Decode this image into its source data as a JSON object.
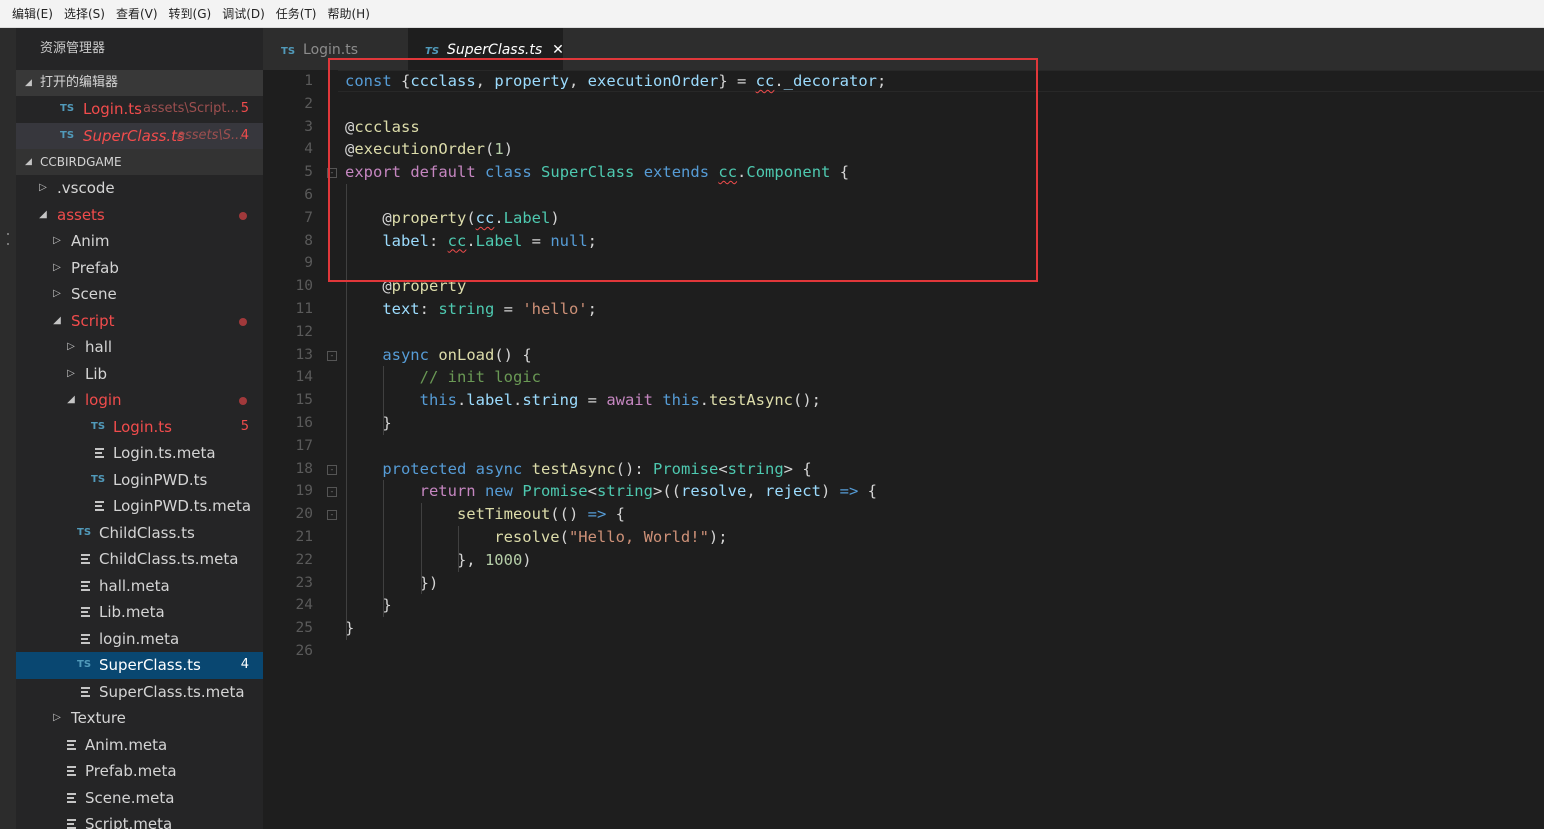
{
  "menu": [
    "编辑(E)",
    "选择(S)",
    "查看(V)",
    "转到(G)",
    "调试(D)",
    "任务(T)",
    "帮助(H)"
  ],
  "sidebar": {
    "title": "资源管理器",
    "open_editors": {
      "header": "打开的编辑器",
      "items": [
        {
          "icon": "TS",
          "name": "Login.ts",
          "path": "assets\\Script...",
          "badge": "5"
        },
        {
          "icon": "TS",
          "name": "SuperClass.ts",
          "path": "assets\\S...",
          "badge": "4"
        }
      ]
    },
    "project": {
      "header": "CCBIRDGAME",
      "items": [
        {
          "name": ".vscode",
          "type": "folder",
          "indent": 0,
          "expanded": false,
          "error": false,
          "badge": ""
        },
        {
          "name": "assets",
          "type": "folder",
          "indent": 0,
          "expanded": true,
          "error": true,
          "badge": ""
        },
        {
          "name": "Anim",
          "type": "folder",
          "indent": 1,
          "expanded": false,
          "error": false,
          "badge": ""
        },
        {
          "name": "Prefab",
          "type": "folder",
          "indent": 1,
          "expanded": false,
          "error": false,
          "badge": ""
        },
        {
          "name": "Scene",
          "type": "folder",
          "indent": 1,
          "expanded": false,
          "error": false,
          "badge": ""
        },
        {
          "name": "Script",
          "type": "folder",
          "indent": 1,
          "expanded": true,
          "error": true,
          "badge": ""
        },
        {
          "name": "hall",
          "type": "folder",
          "indent": 2,
          "expanded": false,
          "error": false,
          "badge": ""
        },
        {
          "name": "Lib",
          "type": "folder",
          "indent": 2,
          "expanded": false,
          "error": false,
          "badge": ""
        },
        {
          "name": "login",
          "type": "folder",
          "indent": 2,
          "expanded": true,
          "error": true,
          "badge": ""
        },
        {
          "name": "Login.ts",
          "type": "ts",
          "indent": 3,
          "expanded": false,
          "error": true,
          "badge": "5"
        },
        {
          "name": "Login.ts.meta",
          "type": "meta",
          "indent": 3,
          "expanded": false,
          "error": false,
          "badge": ""
        },
        {
          "name": "LoginPWD.ts",
          "type": "ts",
          "indent": 3,
          "expanded": false,
          "error": false,
          "badge": ""
        },
        {
          "name": "LoginPWD.ts.meta",
          "type": "meta",
          "indent": 3,
          "expanded": false,
          "error": false,
          "badge": ""
        },
        {
          "name": "ChildClass.ts",
          "type": "ts",
          "indent": 2,
          "expanded": false,
          "error": false,
          "badge": ""
        },
        {
          "name": "ChildClass.ts.meta",
          "type": "meta",
          "indent": 2,
          "expanded": false,
          "error": false,
          "badge": ""
        },
        {
          "name": "hall.meta",
          "type": "meta",
          "indent": 2,
          "expanded": false,
          "error": false,
          "badge": ""
        },
        {
          "name": "Lib.meta",
          "type": "meta",
          "indent": 2,
          "expanded": false,
          "error": false,
          "badge": ""
        },
        {
          "name": "login.meta",
          "type": "meta",
          "indent": 2,
          "expanded": false,
          "error": false,
          "badge": ""
        },
        {
          "name": "SuperClass.ts",
          "type": "ts",
          "indent": 2,
          "expanded": false,
          "error": false,
          "badge": "4",
          "selected": true
        },
        {
          "name": "SuperClass.ts.meta",
          "type": "meta",
          "indent": 2,
          "expanded": false,
          "error": false,
          "badge": ""
        },
        {
          "name": "Texture",
          "type": "folder",
          "indent": 1,
          "expanded": false,
          "error": false,
          "badge": ""
        },
        {
          "name": "Anim.meta",
          "type": "meta",
          "indent": 1,
          "expanded": false,
          "error": false,
          "badge": ""
        },
        {
          "name": "Prefab.meta",
          "type": "meta",
          "indent": 1,
          "expanded": false,
          "error": false,
          "badge": ""
        },
        {
          "name": "Scene.meta",
          "type": "meta",
          "indent": 1,
          "expanded": false,
          "error": false,
          "badge": ""
        },
        {
          "name": "Script.meta",
          "type": "meta",
          "indent": 1,
          "expanded": false,
          "error": false,
          "badge": ""
        }
      ]
    }
  },
  "tabs": [
    {
      "icon": "TS",
      "label": "Login.ts",
      "active": false
    },
    {
      "icon": "TS",
      "label": "SuperClass.ts",
      "active": true,
      "close": "✕"
    }
  ],
  "editor": {
    "lines": [
      {
        "n": "1",
        "indent": 0,
        "fold": "",
        "tokens": [
          [
            "k",
            "const"
          ],
          [
            "p",
            " {"
          ],
          [
            "v",
            "ccclass"
          ],
          [
            "p",
            ", "
          ],
          [
            "v",
            "property"
          ],
          [
            "p",
            ", "
          ],
          [
            "v",
            "executionOrder"
          ],
          [
            "p",
            "} = "
          ],
          [
            "vsq",
            "cc"
          ],
          [
            "p",
            "."
          ],
          [
            "v",
            "_decorator"
          ],
          [
            "p",
            ";"
          ]
        ]
      },
      {
        "n": "2",
        "indent": 0,
        "fold": "",
        "tokens": []
      },
      {
        "n": "3",
        "indent": 0,
        "fold": "",
        "tokens": [
          [
            "p",
            "@"
          ],
          [
            "f",
            "ccclass"
          ]
        ]
      },
      {
        "n": "4",
        "indent": 0,
        "fold": "",
        "tokens": [
          [
            "p",
            "@"
          ],
          [
            "f",
            "executionOrder"
          ],
          [
            "p",
            "("
          ],
          [
            "n",
            "1"
          ],
          [
            "p",
            ")"
          ]
        ]
      },
      {
        "n": "5",
        "indent": 0,
        "fold": "-",
        "tokens": [
          [
            "c",
            "export"
          ],
          [
            "p",
            " "
          ],
          [
            "c",
            "default"
          ],
          [
            "p",
            " "
          ],
          [
            "k",
            "class"
          ],
          [
            "p",
            " "
          ],
          [
            "t",
            "SuperClass"
          ],
          [
            "p",
            " "
          ],
          [
            "k",
            "extends"
          ],
          [
            "p",
            " "
          ],
          [
            "tsq",
            "cc"
          ],
          [
            "p",
            "."
          ],
          [
            "t",
            "Component"
          ],
          [
            "p",
            " {"
          ]
        ]
      },
      {
        "n": "6",
        "indent": 0,
        "fold": "",
        "tokens": []
      },
      {
        "n": "7",
        "indent": 1,
        "fold": "",
        "tokens": [
          [
            "p",
            "@"
          ],
          [
            "f",
            "property"
          ],
          [
            "p",
            "("
          ],
          [
            "vsq",
            "cc"
          ],
          [
            "p",
            "."
          ],
          [
            "t",
            "Label"
          ],
          [
            "p",
            ")"
          ]
        ]
      },
      {
        "n": "8",
        "indent": 1,
        "fold": "",
        "tokens": [
          [
            "v",
            "label"
          ],
          [
            "p",
            ": "
          ],
          [
            "tsq",
            "cc"
          ],
          [
            "p",
            "."
          ],
          [
            "t",
            "Label"
          ],
          [
            "p",
            " = "
          ],
          [
            "k",
            "null"
          ],
          [
            "p",
            ";"
          ]
        ]
      },
      {
        "n": "9",
        "indent": 0,
        "fold": "",
        "tokens": []
      },
      {
        "n": "10",
        "indent": 1,
        "fold": "",
        "tokens": [
          [
            "p",
            "@"
          ],
          [
            "f",
            "property"
          ]
        ]
      },
      {
        "n": "11",
        "indent": 1,
        "fold": "",
        "tokens": [
          [
            "v",
            "text"
          ],
          [
            "p",
            ": "
          ],
          [
            "t",
            "string"
          ],
          [
            "p",
            " = "
          ],
          [
            "s",
            "'hello'"
          ],
          [
            "p",
            ";"
          ]
        ]
      },
      {
        "n": "12",
        "indent": 0,
        "fold": "",
        "tokens": []
      },
      {
        "n": "13",
        "indent": 1,
        "fold": "-",
        "tokens": [
          [
            "k",
            "async"
          ],
          [
            "p",
            " "
          ],
          [
            "f",
            "onLoad"
          ],
          [
            "p",
            "() {"
          ]
        ]
      },
      {
        "n": "14",
        "indent": 2,
        "fold": "",
        "tokens": [
          [
            "cm",
            "// init logic"
          ]
        ]
      },
      {
        "n": "15",
        "indent": 2,
        "fold": "",
        "tokens": [
          [
            "k",
            "this"
          ],
          [
            "p",
            "."
          ],
          [
            "v",
            "label"
          ],
          [
            "p",
            "."
          ],
          [
            "v",
            "string"
          ],
          [
            "p",
            " = "
          ],
          [
            "c",
            "await"
          ],
          [
            "p",
            " "
          ],
          [
            "k",
            "this"
          ],
          [
            "p",
            "."
          ],
          [
            "f",
            "testAsync"
          ],
          [
            "p",
            "();"
          ]
        ]
      },
      {
        "n": "16",
        "indent": 1,
        "fold": "",
        "tokens": [
          [
            "p",
            "}"
          ]
        ]
      },
      {
        "n": "17",
        "indent": 0,
        "fold": "",
        "tokens": []
      },
      {
        "n": "18",
        "indent": 1,
        "fold": "-",
        "tokens": [
          [
            "k",
            "protected"
          ],
          [
            "p",
            " "
          ],
          [
            "k",
            "async"
          ],
          [
            "p",
            " "
          ],
          [
            "f",
            "testAsync"
          ],
          [
            "p",
            "(): "
          ],
          [
            "t",
            "Promise"
          ],
          [
            "p",
            "<"
          ],
          [
            "t",
            "string"
          ],
          [
            "p",
            "> {"
          ]
        ]
      },
      {
        "n": "19",
        "indent": 2,
        "fold": "-",
        "tokens": [
          [
            "c",
            "return"
          ],
          [
            "p",
            " "
          ],
          [
            "k",
            "new"
          ],
          [
            "p",
            " "
          ],
          [
            "t",
            "Promise"
          ],
          [
            "p",
            "<"
          ],
          [
            "t",
            "string"
          ],
          [
            "p",
            ">(("
          ],
          [
            "v",
            "resolve"
          ],
          [
            "p",
            ", "
          ],
          [
            "v",
            "reject"
          ],
          [
            "p",
            ") "
          ],
          [
            "k",
            "=>"
          ],
          [
            "p",
            " {"
          ]
        ]
      },
      {
        "n": "20",
        "indent": 3,
        "fold": "-",
        "tokens": [
          [
            "f",
            "setTimeout"
          ],
          [
            "p",
            "(() "
          ],
          [
            "k",
            "=>"
          ],
          [
            "p",
            " {"
          ]
        ]
      },
      {
        "n": "21",
        "indent": 4,
        "fold": "",
        "tokens": [
          [
            "f",
            "resolve"
          ],
          [
            "p",
            "("
          ],
          [
            "s",
            "\"Hello, World!\""
          ],
          [
            "p",
            ");"
          ]
        ]
      },
      {
        "n": "22",
        "indent": 3,
        "fold": "",
        "tokens": [
          [
            "p",
            "}, "
          ],
          [
            "n",
            "1000"
          ],
          [
            "p",
            ")"
          ]
        ]
      },
      {
        "n": "23",
        "indent": 2,
        "fold": "",
        "tokens": [
          [
            "p",
            "})"
          ]
        ]
      },
      {
        "n": "24",
        "indent": 1,
        "fold": "",
        "tokens": [
          [
            "p",
            "}"
          ]
        ]
      },
      {
        "n": "25",
        "indent": 0,
        "fold": "",
        "tokens": [
          [
            "p",
            "}"
          ]
        ]
      },
      {
        "n": "26",
        "indent": 0,
        "fold": "",
        "tokens": []
      }
    ]
  },
  "colors": {
    "keyword": "#569cd6",
    "control": "#c586c0",
    "function": "#dcdcaa",
    "variable": "#9cdcfe",
    "type": "#4ec9b0",
    "string": "#ce9178",
    "number": "#b5cea8",
    "comment": "#6a9955",
    "error": "#f14c4c",
    "selection": "#094771",
    "annotation_box": "#e0373a"
  }
}
